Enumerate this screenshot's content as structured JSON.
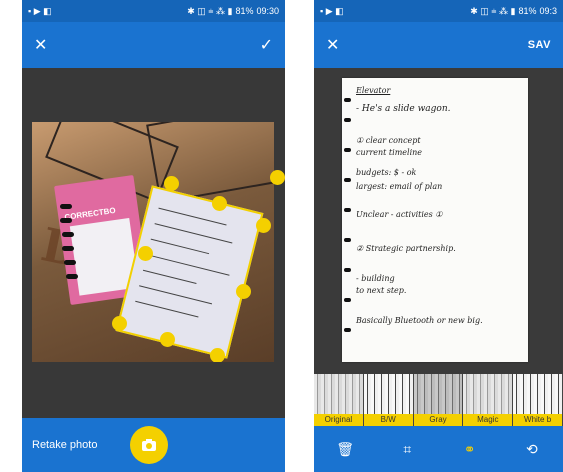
{
  "left_screen": {
    "status": {
      "icons_left": "▪ ▶ ◧",
      "icons_right": "✱ ◫ ⩧ ⁂ ▮",
      "battery": "81%",
      "time": "09:30"
    },
    "appbar": {
      "close_icon": "close-icon",
      "confirm_icon": "check-icon"
    },
    "photo": {
      "pink_card_label": "CORRECTBO",
      "wood_letters": "DECTR"
    },
    "bottom": {
      "retake_label": "Retake photo",
      "shutter_icon": "camera-icon"
    }
  },
  "right_screen": {
    "status": {
      "icons_left": "▪ ▶ ◧",
      "icons_right": "✱ ◫ ⩧ ⁂ ▮",
      "battery": "81%",
      "time": "09:3"
    },
    "appbar": {
      "close_icon": "close-icon",
      "save_label": "SAV"
    },
    "note_lines": [
      "Elevator",
      "- He's a slide wagon.",
      "① clear concept",
      "  current timeline",
      "budgets: $ - ok",
      "largest: email of plan",
      "Unclear - activities ①",
      "② Strategic partnership.",
      "- building",
      "  to next step.",
      "Basically Bluetooth or new big."
    ],
    "filters": [
      "Original",
      "B/W",
      "Gray",
      "Magic",
      "White b"
    ],
    "active_filter_index": 0,
    "toolbar": [
      {
        "name": "trash-icon",
        "glyph": "🗑"
      },
      {
        "name": "crop-icon",
        "glyph": "⌗"
      },
      {
        "name": "filter-icon",
        "glyph": "⚭"
      },
      {
        "name": "rotate-icon",
        "glyph": "⟲"
      }
    ],
    "active_tool": "filter-icon"
  },
  "colors": {
    "primary_blue": "#1a73d0",
    "status_blue": "#1565b8",
    "accent_yellow": "#f4d000",
    "dark_bg": "#383838"
  }
}
